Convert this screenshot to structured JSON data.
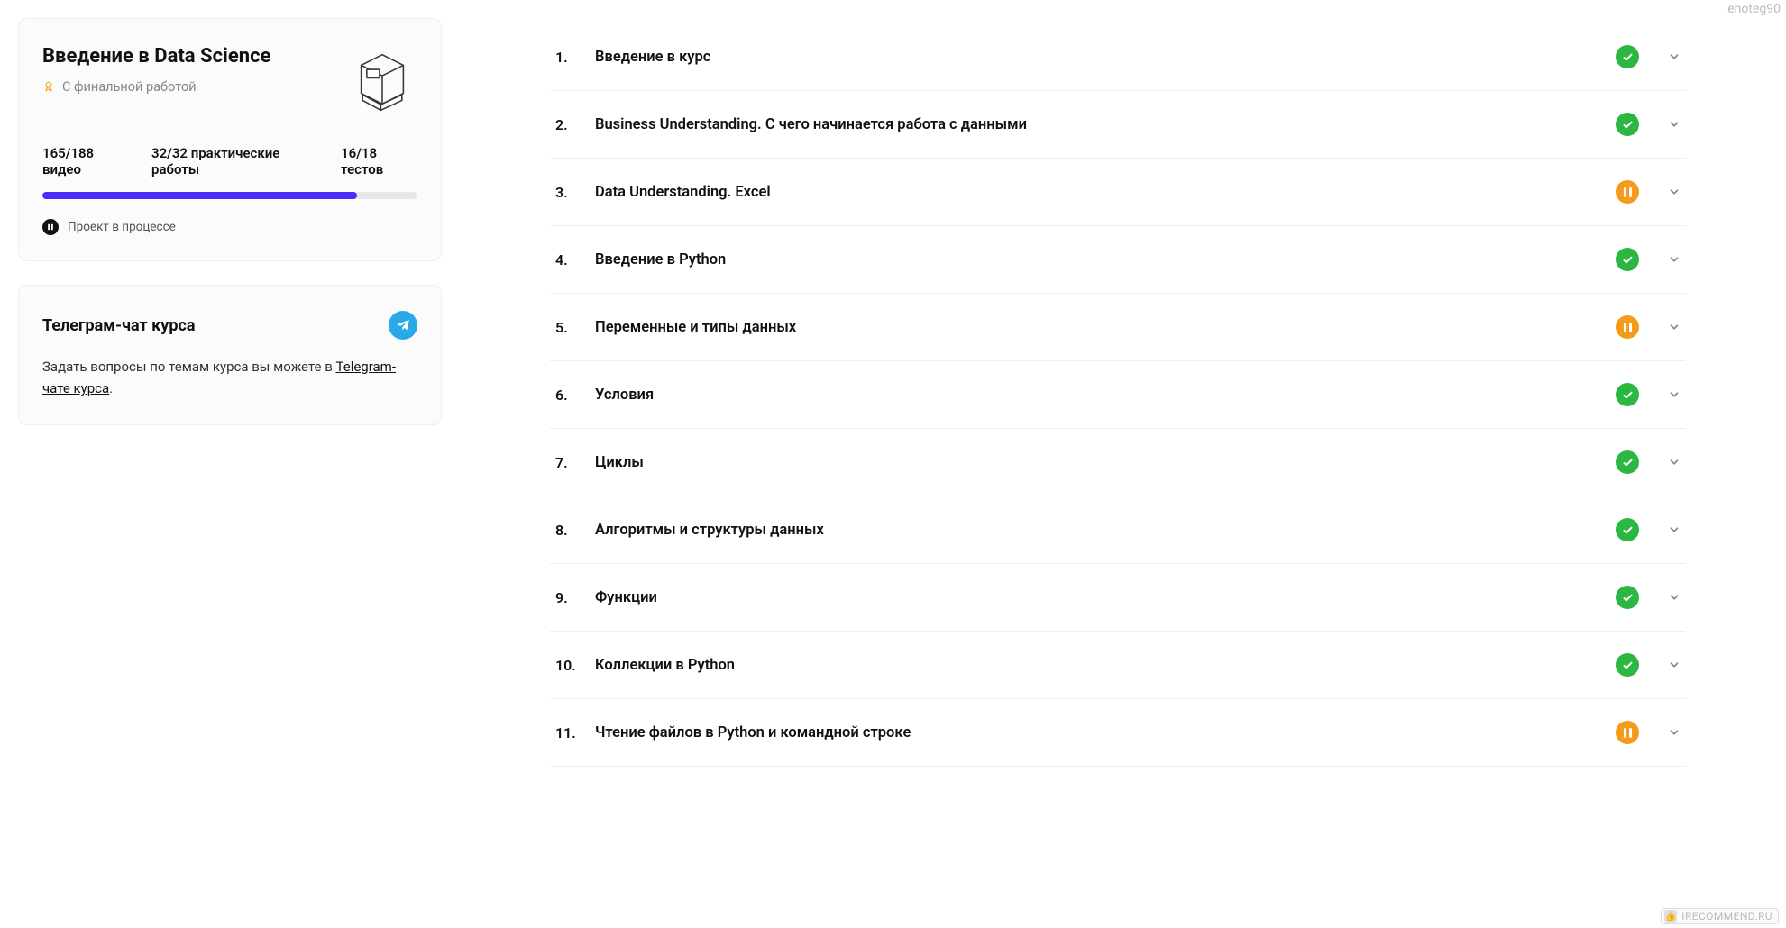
{
  "colors": {
    "accent": "#4a2cff",
    "done": "#2cb742",
    "pause": "#f59b1a",
    "telegram": "#29a9ea"
  },
  "watermark": {
    "user": "enoteg90",
    "site": "IRECOMMEND.RU"
  },
  "course": {
    "title": "Введение в Data Science",
    "final_work_label": "С финальной работой",
    "stats": {
      "videos": "165/188 видео",
      "practice": "32/32 практические работы",
      "tests": "16/18 тестов"
    },
    "progress_percent": 84,
    "project_status_label": "Проект в процессе"
  },
  "telegram": {
    "title": "Телеграм-чат курса",
    "desc_prefix": "Задать вопросы по темам курса вы можете в ",
    "link_text": "Telegram-чате курса",
    "desc_suffix": "."
  },
  "lessons": [
    {
      "num": "1.",
      "title": "Введение в курс",
      "status": "done"
    },
    {
      "num": "2.",
      "title": "Business Understanding. С чего начинается работа с данными",
      "status": "done"
    },
    {
      "num": "3.",
      "title": "Data Understanding. Excel",
      "status": "pause"
    },
    {
      "num": "4.",
      "title": "Введение в Python",
      "status": "done"
    },
    {
      "num": "5.",
      "title": "Переменные и типы данных",
      "status": "pause"
    },
    {
      "num": "6.",
      "title": "Условия",
      "status": "done"
    },
    {
      "num": "7.",
      "title": "Циклы",
      "status": "done"
    },
    {
      "num": "8.",
      "title": "Алгоритмы и структуры данных",
      "status": "done"
    },
    {
      "num": "9.",
      "title": "Функции",
      "status": "done"
    },
    {
      "num": "10.",
      "title": "Коллекции в Python",
      "status": "done"
    },
    {
      "num": "11.",
      "title": "Чтение файлов в Python и командной строке",
      "status": "pause"
    }
  ]
}
